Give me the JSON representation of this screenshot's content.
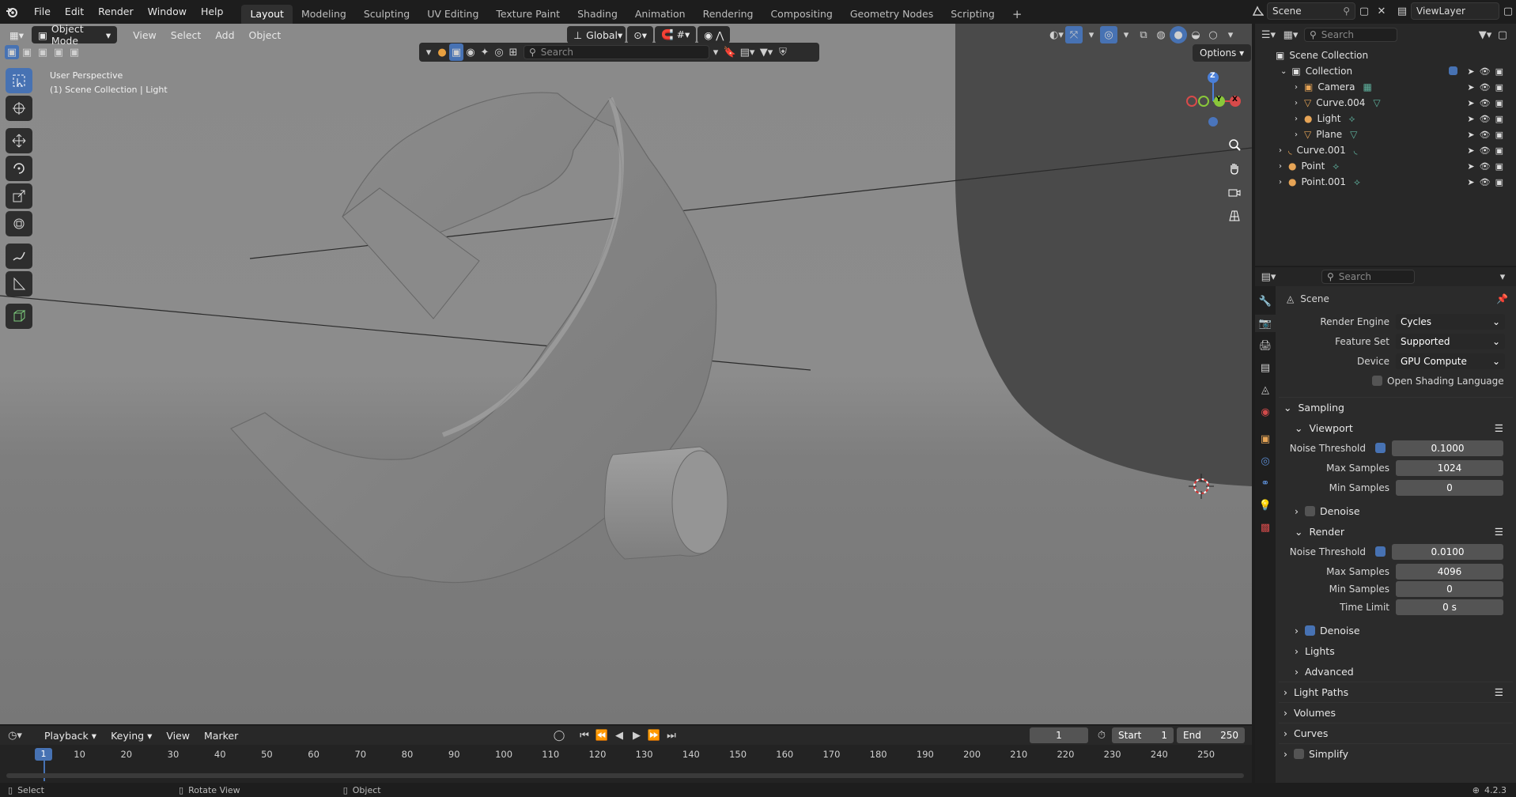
{
  "topbar": {
    "menus": [
      "File",
      "Edit",
      "Render",
      "Window",
      "Help"
    ],
    "workspaces": [
      "Layout",
      "Modeling",
      "Sculpting",
      "UV Editing",
      "Texture Paint",
      "Shading",
      "Animation",
      "Rendering",
      "Compositing",
      "Geometry Nodes",
      "Scripting"
    ],
    "active_workspace": "Layout",
    "add_workspace": "+",
    "scene_name": "Scene",
    "view_layer_name": "ViewLayer"
  },
  "viewport": {
    "mode": "Object Mode",
    "menus": [
      "View",
      "Select",
      "Add",
      "Object"
    ],
    "transform_orientation": "Global",
    "search_placeholder": "Search",
    "options_label": "Options",
    "overlay_line1": "User Perspective",
    "overlay_line2": "(1) Scene Collection | Light",
    "gizmo": {
      "z": "Z",
      "y": "Y",
      "x": "X"
    }
  },
  "outliner": {
    "search_placeholder": "Search",
    "root": "Scene Collection",
    "collection": "Collection",
    "items": [
      {
        "name": "Camera",
        "icon": "camera-icon"
      },
      {
        "name": "Curve.004",
        "icon": "curve-icon"
      },
      {
        "name": "Light",
        "icon": "light-icon"
      },
      {
        "name": "Plane",
        "icon": "mesh-icon"
      }
    ],
    "top_items": [
      {
        "name": "Curve.001",
        "icon": "curve-icon"
      },
      {
        "name": "Point",
        "icon": "light-icon"
      },
      {
        "name": "Point.001",
        "icon": "light-icon"
      }
    ]
  },
  "properties": {
    "search_placeholder": "Search",
    "context": "Scene",
    "render_engine_label": "Render Engine",
    "render_engine": "Cycles",
    "feature_set_label": "Feature Set",
    "feature_set": "Supported",
    "device_label": "Device",
    "device": "GPU Compute",
    "osl_label": "Open Shading Language",
    "sampling": {
      "title": "Sampling",
      "viewport": {
        "title": "Viewport",
        "noise_threshold_label": "Noise Threshold",
        "noise_threshold": "0.1000",
        "max_samples_label": "Max Samples",
        "max_samples": "1024",
        "min_samples_label": "Min Samples",
        "min_samples": "0",
        "denoise_label": "Denoise"
      },
      "render": {
        "title": "Render",
        "noise_threshold_label": "Noise Threshold",
        "noise_threshold": "0.0100",
        "max_samples_label": "Max Samples",
        "max_samples": "4096",
        "min_samples_label": "Min Samples",
        "min_samples": "0",
        "time_limit_label": "Time Limit",
        "time_limit": "0 s",
        "denoise_label": "Denoise"
      },
      "lights": "Lights",
      "advanced": "Advanced"
    },
    "panels": [
      "Light Paths",
      "Volumes",
      "Curves",
      "Simplify"
    ]
  },
  "timeline": {
    "menus": [
      "Playback",
      "Keying",
      "View",
      "Marker"
    ],
    "current_frame": "1",
    "start_label": "Start",
    "start": "1",
    "end_label": "End",
    "end": "250",
    "ticks": [
      "10",
      "20",
      "30",
      "40",
      "50",
      "60",
      "70",
      "80",
      "90",
      "100",
      "110",
      "120",
      "130",
      "140",
      "150",
      "160",
      "170",
      "180",
      "190",
      "200",
      "210",
      "220",
      "230",
      "240",
      "250"
    ],
    "playhead": "1"
  },
  "statusbar": {
    "select": "Select",
    "rotate": "Rotate View",
    "object": "Object",
    "version": "4.2.3"
  }
}
